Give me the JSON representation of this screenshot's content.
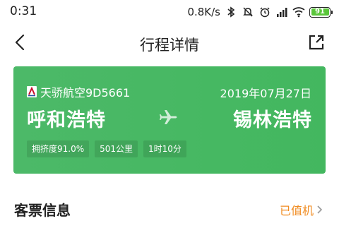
{
  "status_bar": {
    "time": "0:31",
    "net_speed": "0.8K/s",
    "battery": "91",
    "icons": [
      "bluetooth-icon",
      "mute-icon",
      "alarm-icon",
      "hd-signal-icon",
      "wifi-icon",
      "battery-icon"
    ]
  },
  "nav": {
    "title": "行程详情"
  },
  "flight": {
    "airline": "天骄航空9D5661",
    "date": "2019年07月27日",
    "from": "呼和浩特",
    "to": "锡林浩特",
    "tags": [
      "拥挤度91.0%",
      "501公里",
      "1时10分"
    ]
  },
  "ticket": {
    "title": "客票信息",
    "status": "已值机"
  },
  "colors": {
    "card_green": "#43b75f",
    "status_orange": "#f08c22",
    "battery_green": "#5ac63a"
  }
}
